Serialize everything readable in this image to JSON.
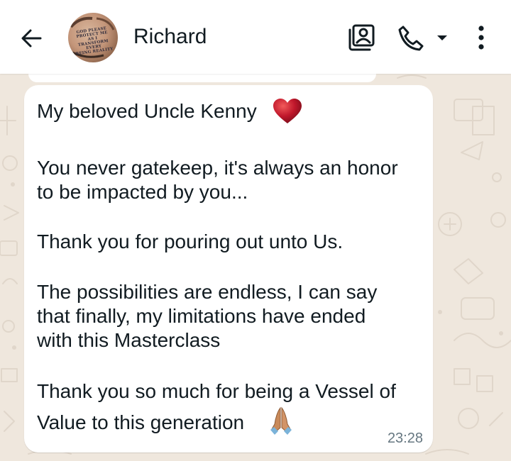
{
  "header": {
    "contact_name": "Richard",
    "avatar_text": [
      "GOD PLEASE",
      "PROTECT ME AS I",
      "TRANSFORM EVERY",
      "BEING REALITY"
    ],
    "icons": {
      "back": "arrow-left-icon",
      "video": "contact-card-icon",
      "call": "phone-icon",
      "call_dropdown": "caret-down-icon",
      "menu": "more-vertical-icon"
    }
  },
  "message": {
    "lines": [
      "My beloved Uncle Kenny",
      "You never gatekeep, it's always an honor",
      "to be impacted by you...",
      "Thank you for pouring out unto Us.",
      "The possibilities are endless, I can say",
      "that finally, my limitations have ended",
      "with this Masterclass",
      "Thank you so much for being a Vessel of",
      "Value to this generation"
    ],
    "emojis": [
      "red-heart-emoji",
      "folded-hands-emoji"
    ],
    "timestamp": "23:28"
  },
  "colors": {
    "wallpaper": "#efe7dd",
    "bubble": "#ffffff",
    "text": "#111b21",
    "timestamp": "#667781",
    "heart": "#c0172b"
  }
}
